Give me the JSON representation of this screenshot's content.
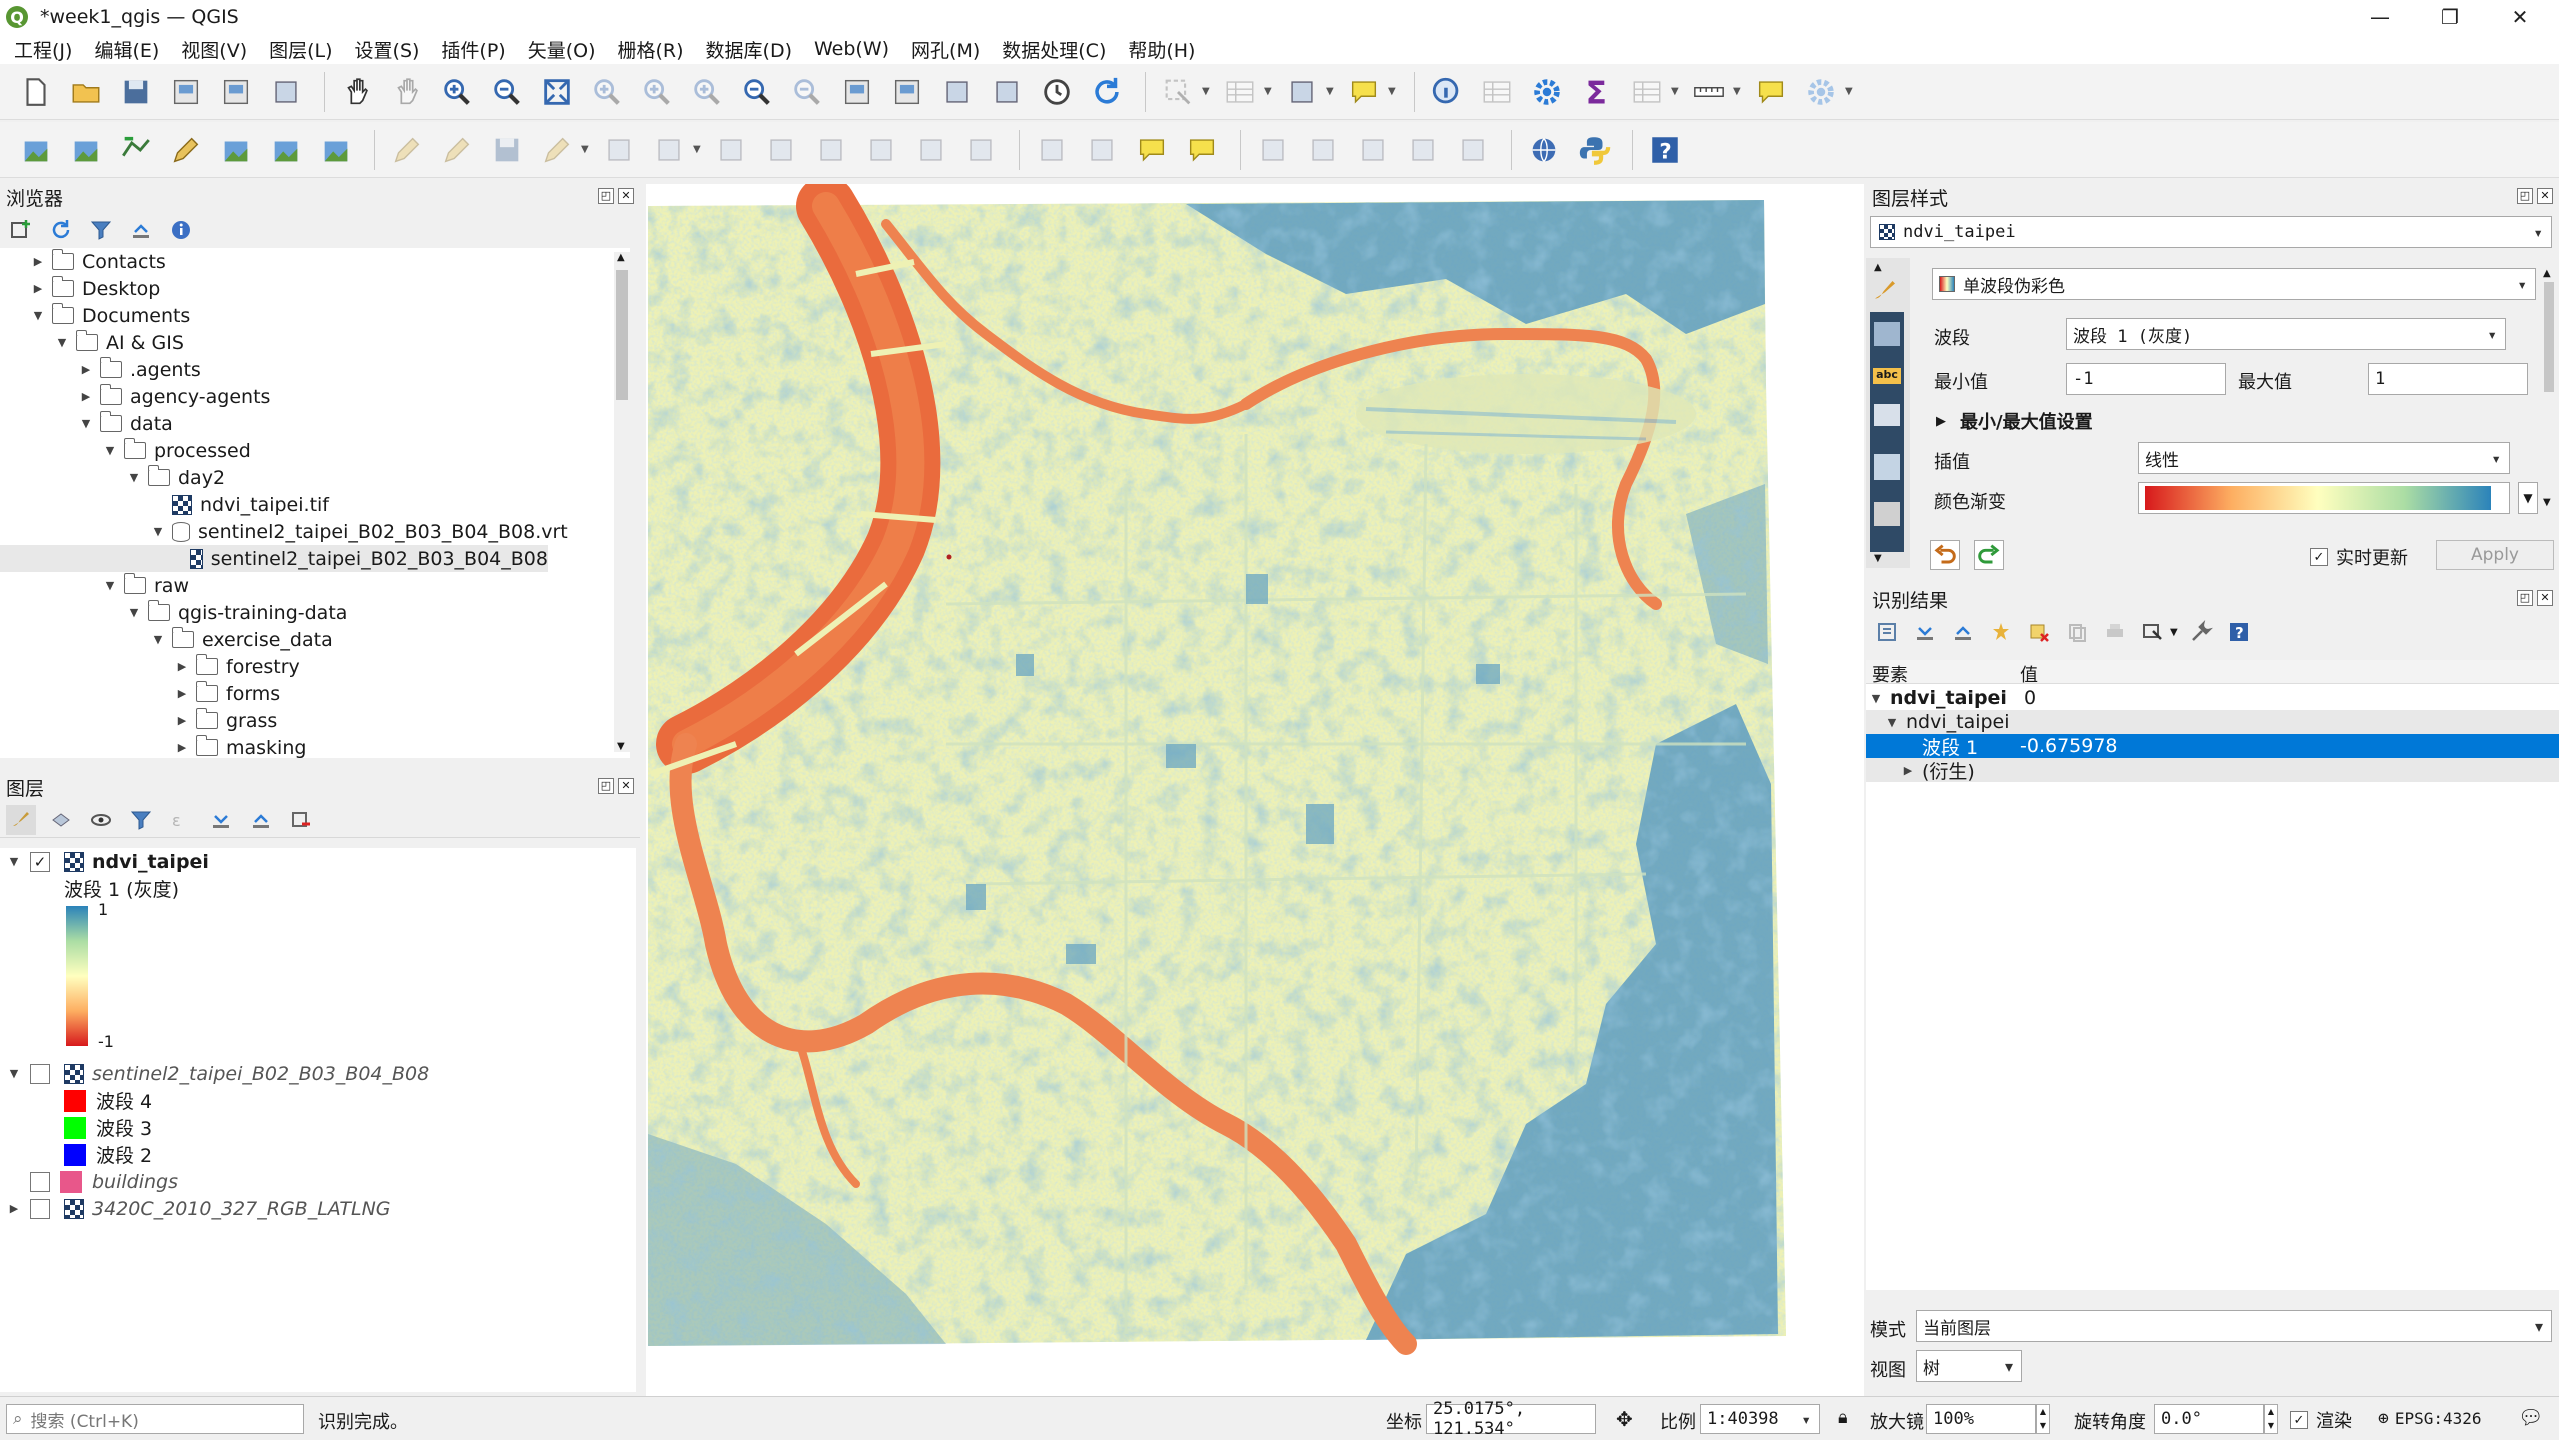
{
  "window": {
    "title": "*week1_qgis — QGIS",
    "app_icon": "qgis-logo-icon"
  },
  "menu": [
    "工程(J)",
    "编辑(E)",
    "视图(V)",
    "图层(L)",
    "设置(S)",
    "插件(P)",
    "矢量(O)",
    "栅格(R)",
    "数据库(D)",
    "Web(W)",
    "网孔(M)",
    "数据处理(C)",
    "帮助(H)"
  ],
  "browser": {
    "title": "浏览器",
    "items": [
      {
        "label": "Contacts",
        "depth": 0,
        "expand": "collapsed",
        "icon": "folder-icon"
      },
      {
        "label": "Desktop",
        "depth": 0,
        "expand": "collapsed",
        "icon": "folder-icon"
      },
      {
        "label": "Documents",
        "depth": 0,
        "expand": "expanded",
        "icon": "folder-icon"
      },
      {
        "label": "AI & GIS",
        "depth": 1,
        "expand": "expanded",
        "icon": "folder-icon"
      },
      {
        "label": ".agents",
        "depth": 2,
        "expand": "collapsed",
        "icon": "folder-icon"
      },
      {
        "label": "agency-agents",
        "depth": 2,
        "expand": "collapsed",
        "icon": "folder-icon"
      },
      {
        "label": "data",
        "depth": 2,
        "expand": "expanded",
        "icon": "folder-icon"
      },
      {
        "label": "processed",
        "depth": 3,
        "expand": "expanded",
        "icon": "folder-icon"
      },
      {
        "label": "day2",
        "depth": 4,
        "expand": "expanded",
        "icon": "folder-icon"
      },
      {
        "label": "ndvi_taipei.tif",
        "depth": 5,
        "expand": "none",
        "icon": "raster-icon"
      },
      {
        "label": "sentinel2_taipei_B02_B03_B04_B08.vrt",
        "depth": 5,
        "expand": "expanded",
        "icon": "vrt-icon"
      },
      {
        "label": "sentinel2_taipei_B02_B03_B04_B08",
        "depth": 6,
        "expand": "none",
        "icon": "raster-icon",
        "selected": true
      },
      {
        "label": "raw",
        "depth": 3,
        "expand": "expanded",
        "icon": "folder-icon"
      },
      {
        "label": "qgis-training-data",
        "depth": 4,
        "expand": "expanded",
        "icon": "folder-icon"
      },
      {
        "label": "exercise_data",
        "depth": 5,
        "expand": "expanded",
        "icon": "folder-icon"
      },
      {
        "label": "forestry",
        "depth": 6,
        "expand": "collapsed",
        "icon": "folder-icon"
      },
      {
        "label": "forms",
        "depth": 6,
        "expand": "collapsed",
        "icon": "folder-icon"
      },
      {
        "label": "grass",
        "depth": 6,
        "expand": "collapsed",
        "icon": "folder-icon"
      },
      {
        "label": "masking",
        "depth": 6,
        "expand": "collapsed",
        "icon": "folder-icon"
      }
    ]
  },
  "layers": {
    "title": "图层",
    "ndvi": {
      "name": "ndvi_taipei",
      "checked": true,
      "band": "波段 1 (灰度)",
      "max": "1",
      "min": "-1"
    },
    "sentinel": {
      "name": "sentinel2_taipei_B02_B03_B04_B08",
      "checked": false,
      "bands": [
        {
          "label": "波段 4",
          "color": "#ff0000"
        },
        {
          "label": "波段 3",
          "color": "#00ff00"
        },
        {
          "label": "波段 2",
          "color": "#0000ff"
        }
      ]
    },
    "buildings": {
      "name": "buildings",
      "checked": false,
      "color": "#e8578a"
    },
    "latlng": {
      "name": "3420C_2010_327_RGB_LATLNG",
      "checked": false
    }
  },
  "style_panel": {
    "title": "图层样式",
    "layer": "ndvi_taipei",
    "renderer": "单波段伪彩色",
    "band_label": "波段",
    "band_value": "波段 1 (灰度)",
    "min_label": "最小值",
    "min_value": "-1",
    "max_label": "最大值",
    "max_value": "1",
    "minmax_settings": "最小/最大值设置",
    "interp_label": "插值",
    "interp_value": "线性",
    "ramp_label": "颜色渐变",
    "live_update": "实时更新",
    "apply": "Apply"
  },
  "identify": {
    "title": "识别结果",
    "col_feature": "要素",
    "col_value": "值",
    "rows": [
      {
        "feature": "ndvi_taipei",
        "value": "0",
        "bold": true
      },
      {
        "feature": "ndvi_taipei",
        "value": ""
      },
      {
        "feature": "波段 1",
        "value": "-0.675978",
        "selected": true
      },
      {
        "feature": "(衍生)",
        "value": ""
      }
    ],
    "mode_label": "模式",
    "mode_value": "当前图层",
    "view_label": "视图",
    "view_value": "树"
  },
  "status": {
    "search_placeholder": "搜索 (Ctrl+K)",
    "message": "识别完成。",
    "coord_label": "坐标",
    "coord_value": "25.0175°, 121.534°",
    "scale_label": "比例",
    "scale_value": "1:40398",
    "magnifier_label": "放大镜",
    "magnifier_value": "100%",
    "rotation_label": "旋转角度",
    "rotation_value": "0.0°",
    "render_label": "渲染",
    "crs": "EPSG:4326"
  },
  "colors": {
    "ramp_low": "#d7191c",
    "ramp_mid": "#ffffbf",
    "ramp_high": "#2b83ba",
    "selection": "#0078d7"
  }
}
